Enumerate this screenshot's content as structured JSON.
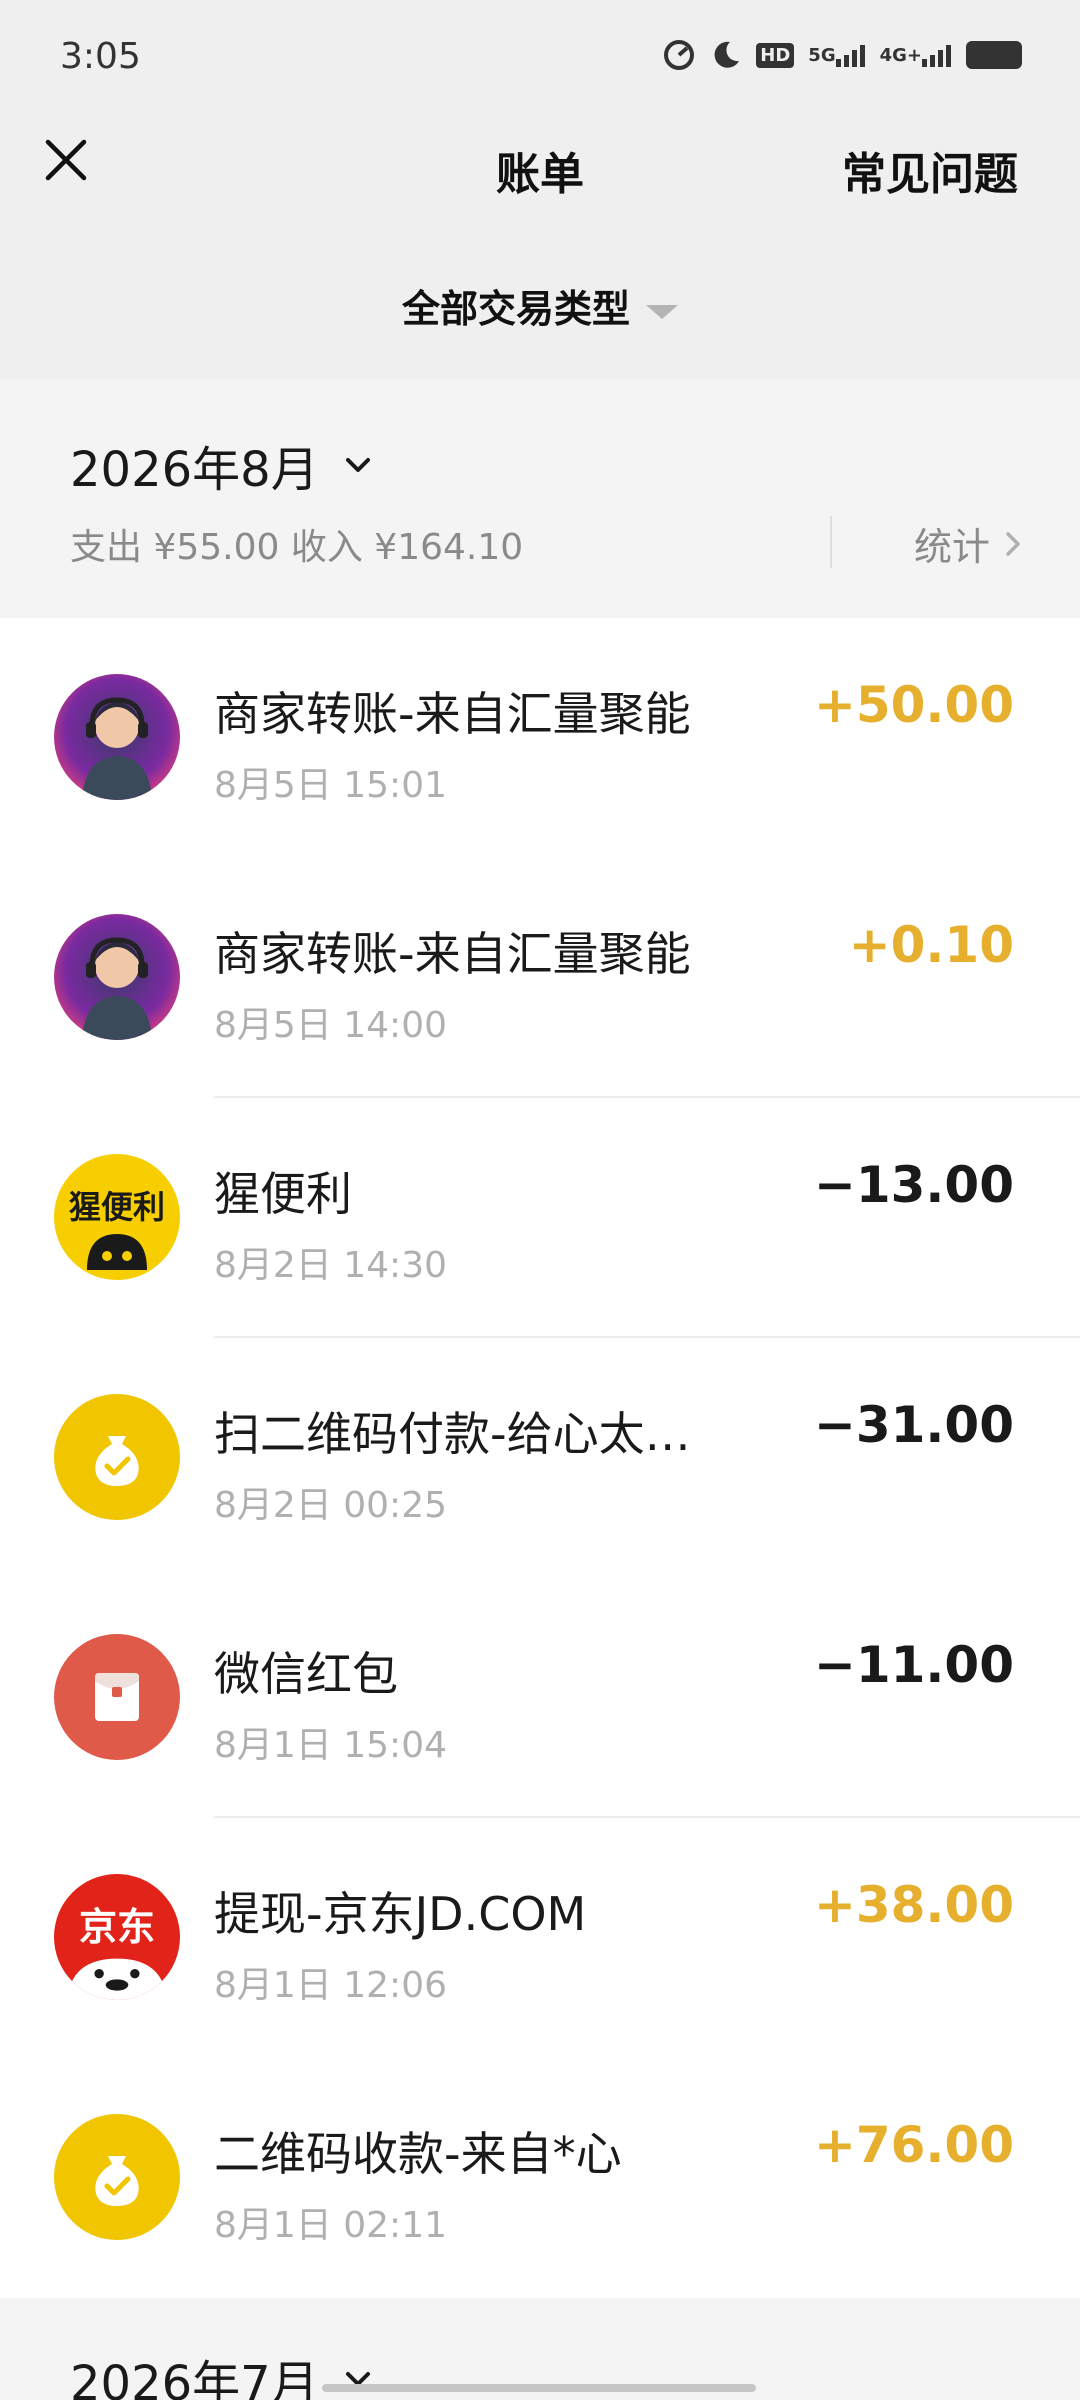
{
  "status_bar": {
    "time": "3:05",
    "icons": [
      "speed-icon",
      "moon-icon",
      "hd-icon",
      "5g-signal-icon",
      "4g-signal-icon",
      "battery-icon"
    ],
    "hd_label": "HD",
    "net_5g": "5G",
    "net_4g": "4G+"
  },
  "nav": {
    "title": "账单",
    "faq": "常见问题"
  },
  "filter": {
    "label": "全部交易类型"
  },
  "month": {
    "title": "2026年8月",
    "summary": "支出 ¥55.00 收入 ¥164.10",
    "stats": "统计"
  },
  "transactions": [
    {
      "title": "商家转账-来自汇量聚能",
      "time": "8月5日 15:01",
      "amount": "+50.00",
      "avatar": "merchant-avatar"
    },
    {
      "title": "商家转账-来自汇量聚能",
      "time": "8月5日 14:00",
      "amount": "+0.10",
      "avatar": "merchant-avatar"
    },
    {
      "title": "猩便利",
      "time": "8月2日 14:30",
      "amount": "−13.00",
      "avatar": "xingbianli-logo",
      "logo_text": "猩便利"
    },
    {
      "title": "扫二维码付款-给心太…",
      "time": "8月2日 00:25",
      "amount": "−31.00",
      "avatar": "money-bag-icon"
    },
    {
      "title": "微信红包",
      "time": "8月1日 15:04",
      "amount": "−11.00",
      "avatar": "red-packet-icon"
    },
    {
      "title": "提现-京东JD.COM",
      "time": "8月1日 12:06",
      "amount": "+38.00",
      "avatar": "jd-logo",
      "logo_text": "京东"
    },
    {
      "title": "二维码收款-来自*心",
      "time": "8月1日 02:11",
      "amount": "+76.00",
      "avatar": "money-bag-icon"
    }
  ],
  "next_month": {
    "title": "2026年7月"
  },
  "colors": {
    "income": "#e6b02e",
    "expense": "#1a1a1a",
    "red_packet": "#e05a4a",
    "money_bag": "#f1c500",
    "jd_red": "#e2231a"
  }
}
